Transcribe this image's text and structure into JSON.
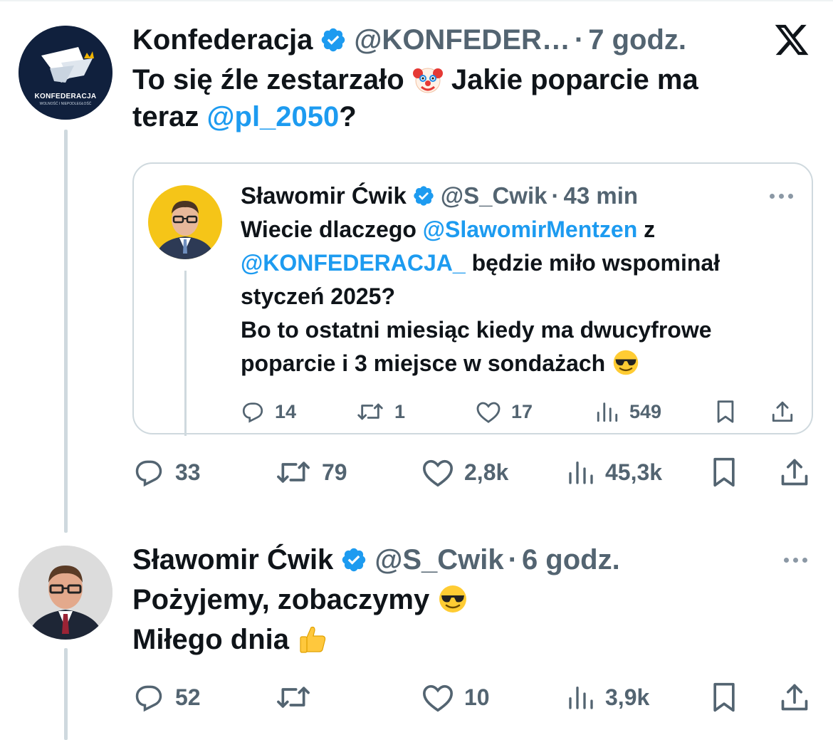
{
  "colors": {
    "link": "#1d9bf0",
    "verified": "#1d9bf0",
    "muted": "#536471",
    "thread_line": "#cfd9de",
    "text": "#0f1419"
  },
  "platform_icon": "x-logo-icon",
  "tweet1": {
    "author_name": "Konfederacja",
    "handle": "@KONFEDER…",
    "separator": "·",
    "time": "7 godz.",
    "text_part1": "To się źle zestarzało",
    "text_emoji": "clown-face-emoji",
    "text_part2": " Jakie poparcie ma",
    "text_part3": "teraz ",
    "mention": "@pl_2050",
    "text_part4": "?",
    "avatar_label": "KONFEDERACJA",
    "avatar_sublabel": "WOLNOŚĆ I NIEPODLEGŁOŚĆ",
    "stats": {
      "replies": "33",
      "retweets": "79",
      "likes": "2,8k",
      "views": "45,3k"
    }
  },
  "quote": {
    "author_name": "Sławomir Ćwik",
    "handle": "@S_Cwik",
    "separator": "·",
    "time": "43 min",
    "line1_a": "Wiecie dlaczego ",
    "line1_mention": "@SlawomirMentzen",
    "line1_b": " z",
    "line2_mention": "@KONFEDERACJA_",
    "line2_b": " będzie miło wspominał",
    "line3": "styczeń 2025?",
    "line4": "Bo to ostatni miesiąc kiedy ma dwucyfrowe",
    "line5": "poparcie i 3 miejsce w sondażach ",
    "emoji": "sunglasses-emoji",
    "stats": {
      "replies": "14",
      "retweets": "1",
      "likes": "17",
      "views": "549"
    }
  },
  "tweet2": {
    "author_name": "Sławomir Ćwik",
    "handle": "@S_Cwik",
    "separator": "·",
    "time": "6 godz.",
    "line1": "Pożyjemy, zobaczymy ",
    "line1_emoji": "sunglasses-emoji",
    "line2": "Miłego dnia ",
    "line2_emoji": "thumbs-up-emoji",
    "stats": {
      "replies": "52",
      "retweets": "",
      "likes": "10",
      "views": "3,9k"
    }
  }
}
